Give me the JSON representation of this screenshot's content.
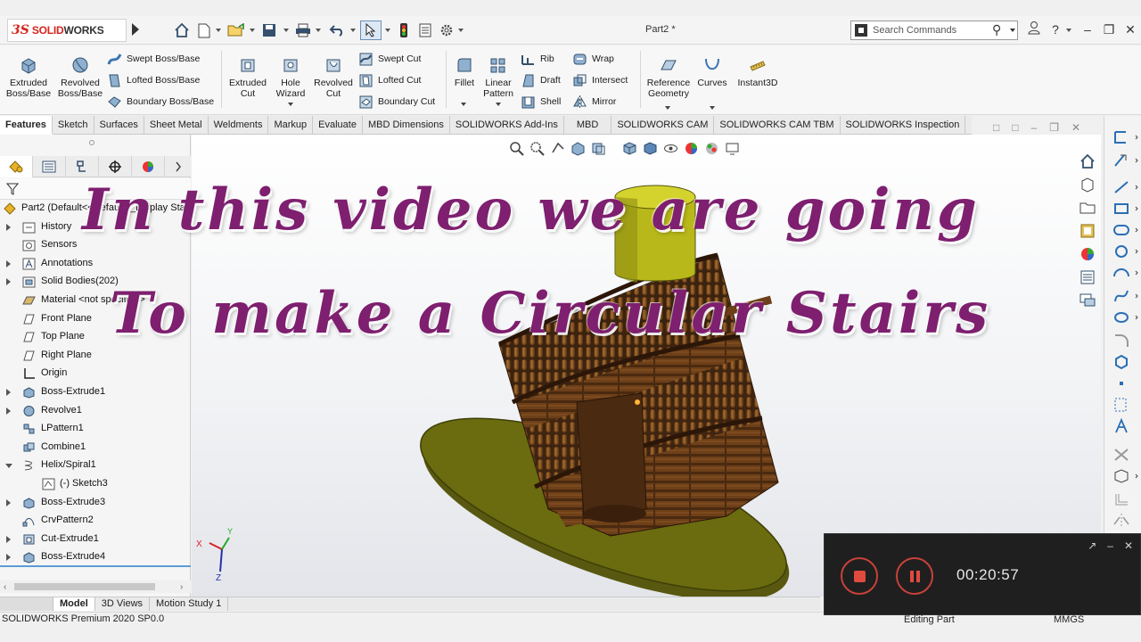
{
  "app": {
    "logo_ds": "3S",
    "logo_brand_a": "SOLID",
    "logo_brand_b": "WORKS",
    "document_title": "Part2 *"
  },
  "search": {
    "placeholder": "Search Commands"
  },
  "ribbon": {
    "extruded_boss": "Extruded Boss/Base",
    "revolved_boss": "Revolved Boss/Base",
    "swept_boss": "Swept Boss/Base",
    "lofted_boss": "Lofted Boss/Base",
    "boundary_boss": "Boundary Boss/Base",
    "extruded_cut": "Extruded Cut",
    "hole_wizard": "Hole Wizard",
    "revolved_cut": "Revolved Cut",
    "swept_cut": "Swept Cut",
    "lofted_cut": "Lofted Cut",
    "boundary_cut": "Boundary Cut",
    "fillet": "Fillet",
    "linear_pattern": "Linear Pattern",
    "rib": "Rib",
    "draft": "Draft",
    "shell": "Shell",
    "wrap": "Wrap",
    "intersect": "Intersect",
    "mirror": "Mirror",
    "reference_geometry": "Reference Geometry",
    "curves": "Curves",
    "instant3d": "Instant3D"
  },
  "tabs": [
    "Features",
    "Sketch",
    "Surfaces",
    "Sheet Metal",
    "Weldments",
    "Markup",
    "Evaluate",
    "MBD Dimensions",
    "SOLIDWORKS Add-Ins",
    "MBD",
    "SOLIDWORKS CAM",
    "SOLIDWORKS CAM TBM",
    "SOLIDWORKS Inspection"
  ],
  "tree": {
    "root": "Part2  (Default<<Default>_Display State 1>)",
    "items": [
      "History",
      "Sensors",
      "Annotations",
      "Solid Bodies(202)",
      "Material <not specified>",
      "Front Plane",
      "Top Plane",
      "Right Plane",
      "Origin",
      "Boss-Extrude1",
      "Revolve1",
      "LPattern1",
      "Combine1",
      "Helix/Spiral1",
      "(-) Sketch3",
      "Boss-Extrude3",
      "CrvPattern2",
      "Cut-Extrude1",
      "Boss-Extrude4"
    ]
  },
  "bottom_tabs": [
    "Model",
    "3D Views",
    "Motion Study 1"
  ],
  "status": {
    "version": "SOLIDWORKS Premium 2020 SP0.0",
    "mode": "Editing Part",
    "units": "MMGS"
  },
  "overlay": {
    "line1": "In this video we are going",
    "line2": "To make a Circular Stairs"
  },
  "recorder": {
    "time": "00:20:57"
  },
  "triad": {
    "x": "X",
    "y": "Y",
    "z": "Z"
  },
  "colors": {
    "overlay_text": "#7e1f6f",
    "model_base": "#6b6b0f",
    "model_wood": "#5a3412",
    "model_cylinder": "#b9b81a",
    "recorder_red": "#e14a3f"
  }
}
